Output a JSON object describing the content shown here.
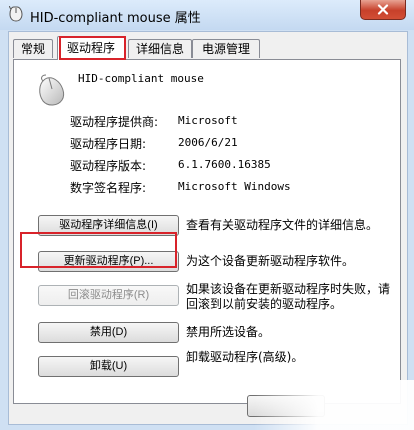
{
  "window": {
    "title": "HID-compliant mouse 属性",
    "close_icon": "close-icon",
    "title_icon": "mouse-icon"
  },
  "tabs": [
    {
      "label": "常规",
      "active": false
    },
    {
      "label": "驱动程序",
      "active": true
    },
    {
      "label": "详细信息",
      "active": false
    },
    {
      "label": "电源管理",
      "active": false
    }
  ],
  "device": {
    "name": "HID-compliant mouse",
    "icon": "mouse-icon"
  },
  "properties": [
    {
      "label": "驱动程序提供商:",
      "value": "Microsoft"
    },
    {
      "label": "驱动程序日期:",
      "value": "2006/6/21"
    },
    {
      "label": "驱动程序版本:",
      "value": "6.1.7600.16385"
    },
    {
      "label": "数字签名程序:",
      "value": "Microsoft Windows"
    }
  ],
  "actions": [
    {
      "button": "驱动程序详细信息(I)",
      "desc": "查看有关驱动程序文件的详细信息。",
      "enabled": true
    },
    {
      "button": "更新驱动程序(P)...",
      "desc": "为这个设备更新驱动程序软件。",
      "enabled": true
    },
    {
      "button": "回滚驱动程序(R)",
      "desc": "如果该设备在更新驱动程序时失败，请回滚到以前安装的驱动程序。",
      "enabled": false
    },
    {
      "button": "禁用(D)",
      "desc": "禁用所选设备。",
      "enabled": true
    },
    {
      "button": "卸载(U)",
      "desc": "卸载驱动程序(高级)。",
      "enabled": true
    }
  ],
  "colors": {
    "highlight_box": "#d8232a",
    "titlebar": "#c4d9f1",
    "close_button": "#c7402a"
  }
}
